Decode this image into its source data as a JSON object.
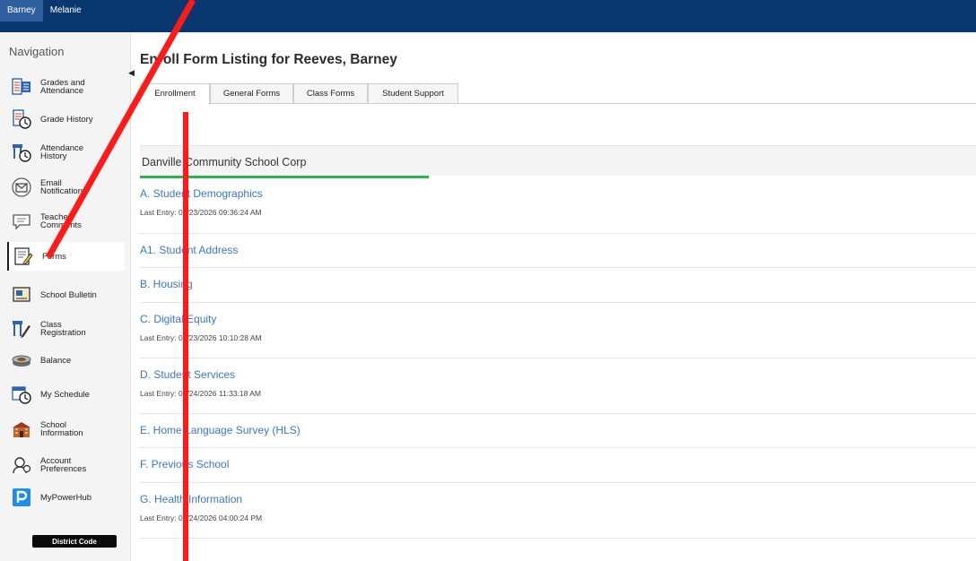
{
  "topbar": {
    "students": [
      {
        "label": "Barney",
        "active": true
      },
      {
        "label": "Melanie",
        "active": false
      }
    ]
  },
  "sidebar": {
    "title": "Navigation",
    "items": [
      {
        "label": "Grades and\nAttendance",
        "icon": "grades-attendance-icon"
      },
      {
        "label": "Grade History",
        "icon": "grade-history-icon"
      },
      {
        "label": "Attendance\nHistory",
        "icon": "attendance-history-icon"
      },
      {
        "label": "Email\nNotification",
        "icon": "email-icon"
      },
      {
        "label": "Teacher\nComments",
        "icon": "comments-icon"
      },
      {
        "label": "Forms",
        "icon": "forms-icon",
        "active": true
      },
      {
        "label": "School Bulletin",
        "icon": "bulletin-icon"
      },
      {
        "label": "Class\nRegistration",
        "icon": "class-registration-icon"
      },
      {
        "label": "Balance",
        "icon": "balance-icon"
      },
      {
        "label": "My Schedule",
        "icon": "schedule-icon"
      },
      {
        "label": "School\nInformation",
        "icon": "school-icon"
      },
      {
        "label": "Account\nPreferences",
        "icon": "account-preferences-icon"
      },
      {
        "label": "MyPowerHub",
        "icon": "mypowerhub-icon"
      }
    ],
    "district_code_label": "District Code"
  },
  "main": {
    "title": "Enroll Form Listing for Reeves, Barney",
    "tabs": [
      {
        "label": "Enrollment",
        "active": true
      },
      {
        "label": "General Forms"
      },
      {
        "label": "Class Forms"
      },
      {
        "label": "Student Support"
      }
    ],
    "school_name": "Danville Community School Corp",
    "forms": [
      {
        "title": "A. Student Demographics",
        "last_entry": "Last Entry: 02/23/2026 09:36:24 AM"
      },
      {
        "title": "A1. Student Address",
        "last_entry": ""
      },
      {
        "title": "B. Housing",
        "last_entry": ""
      },
      {
        "title": "C. Digital Equity",
        "last_entry": "Last Entry: 02/23/2026 10:10:28 AM"
      },
      {
        "title": "D. Student Services",
        "last_entry": "Last Entry: 02/24/2026 11:33:18 AM"
      },
      {
        "title": "E. Home Language Survey (HLS)",
        "last_entry": ""
      },
      {
        "title": "F. Previous School",
        "last_entry": ""
      },
      {
        "title": "G. Health Information",
        "last_entry": "Last Entry: 02/24/2026 04:00:24 PM"
      }
    ]
  },
  "colors": {
    "topbar": "#0a3770",
    "link": "#3b78c3",
    "accent_green": "#2bb24c",
    "annotation_red": "#ff1a1a"
  }
}
